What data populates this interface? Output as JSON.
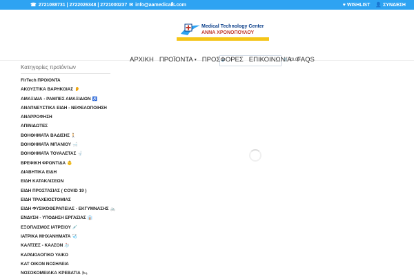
{
  "topbar": {
    "phones": "2721088731 | 2722026348 | 2721000237",
    "email": "info@aamedicals.com",
    "wishlist": "WISHLIST",
    "login": "ΣΥΝΔΕΣΗ"
  },
  "logo": {
    "line1": "Medical Technology Center",
    "line2": "ΑΝΝΑ ΧΡΟΝΟΠΟΥΛΟΥ"
  },
  "nav": {
    "home": "ΑΡΧΙΚΗ",
    "products": "ΠΡΟΪΟΝΤΑ",
    "offers": "ΠΡΟΣΦΟΡΕΣ",
    "contact": "ΕΠΙΚΟΙΝΩΝΙΑ",
    "faqs": "FAQS",
    "cart": "€0.00"
  },
  "sidebar": {
    "title": "Κατηγορίες προϊόντων",
    "items": [
      {
        "label": "FirTech ΠΡΟΙΟΝΤΑ",
        "emoji": ""
      },
      {
        "label": "ΑΚΟΥΣΤΙΚΑ ΒΑΡΗΚΟΙΑΣ",
        "emoji": "👂"
      },
      {
        "label": "ΑΜΑΞΙΔΙΑ - ΡΑΜΠΕΣ ΑΜΑΞΙΔΙΩΝ",
        "emoji": "♿"
      },
      {
        "label": "ΑΝΑΠΝΕΥΣΤΙΚΑ ΕΙΔΗ - ΝΕΦΕΛΟΠΟΙΗΣΗ",
        "emoji": ""
      },
      {
        "label": "ΑΝΑΡΡΟΦΗΣΗ",
        "emoji": ""
      },
      {
        "label": "ΑΠΙΝΙΔΩΤΕΣ",
        "emoji": ""
      },
      {
        "label": "ΒΟΗΘΗΜΑΤΑ ΒΑΔΙΣΗΣ",
        "emoji": "🚶"
      },
      {
        "label": "ΒΟΗΘΗΜΑΤΑ ΜΠΑΝΙΟΥ",
        "emoji": "🛁"
      },
      {
        "label": "ΒΟΗΘΗΜΑΤΑ ΤΟΥΑΛΕΤΑΣ",
        "emoji": "🚽"
      },
      {
        "label": "ΒΡΕΦΙΚΗ ΦΡΟΝΤΙΔΑ",
        "emoji": "👶"
      },
      {
        "label": "ΔΙΑΒΗΤΙΚΑ ΕΙΔΗ",
        "emoji": ""
      },
      {
        "label": "ΕΙΔΗ ΚΑΤΑΚΛΙΣΕΩΝ",
        "emoji": ""
      },
      {
        "label": "ΕΙΔΗ ΠΡΟΣΤΑΣΙΑΣ ( COVID 19 )",
        "emoji": ""
      },
      {
        "label": "ΕΙΔΗ ΤΡΑΧΕΙΟΣΤΟΜΙΑΣ",
        "emoji": ""
      },
      {
        "label": "ΕΙΔΗ ΦΥΣΙΚΟΘΕΡΑΠΕΙΑΣ - ΕΚΓΥΜΝΑΣΗΣ",
        "emoji": "🚲"
      },
      {
        "label": "ΕΝΔΥΣΗ - ΥΠΟΔΗΣΗ ΕΡΓΑΣΙΑΣ",
        "emoji": "👔"
      },
      {
        "label": "ΕΞΟΠΛΙΣΜΟΣ ΙΑΤΡΕΙΟΥ",
        "emoji": "💉"
      },
      {
        "label": "ΙΑΤΡΙΚΑ ΜΗΧΑΝΗΜΑΤΑ",
        "emoji": "🩺"
      },
      {
        "label": "ΚΑΛΤΣΕΣ - ΚΑΛΣΟΝ",
        "emoji": "🧦"
      },
      {
        "label": "ΚΑΡΔΙΟΛΟΓΙΚΟ ΥΛΙΚΟ",
        "emoji": ""
      },
      {
        "label": "ΚΑΤ ΟΙΚΟΝ ΝΟΣΗΛΕΙΑ",
        "emoji": ""
      },
      {
        "label": "ΝΟΣΟΚΟΜΕΙΑΚΑ ΚΡΕΒΑΤΙΑ",
        "emoji": "🛏"
      }
    ]
  },
  "colors": {
    "topbar": "#2ea3f2",
    "logo_blue": "#0b3f8a",
    "logo_red": "#c0392b",
    "logo_yellow": "#f5c518"
  },
  "icons": {
    "phone": "phone-icon",
    "email": "email-icon",
    "facebook": "facebook-icon",
    "wishlist": "heart-icon",
    "login": "user-icon",
    "search": "search-icon",
    "cart": "cart-icon",
    "loading": "loading-spinner"
  }
}
